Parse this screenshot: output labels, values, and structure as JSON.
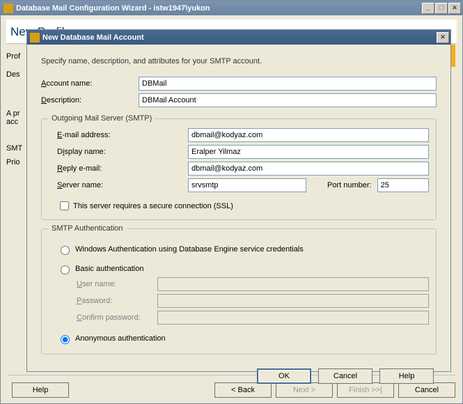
{
  "bg_window": {
    "title": "Database Mail Configuration Wizard - istw1947\\yukon",
    "heading_prefix": "New ",
    "heading_rest_trunc": "Profile",
    "labels": {
      "profile_short": "Prof",
      "desc_short": "Des",
      "smtp_short": "SMT",
      "priority_short": "Prio",
      "apr_line": "A pr",
      "acc_line": "acc"
    },
    "buttons": {
      "help": "Help",
      "back": "< Back",
      "next": "Next >",
      "finish": "Finish >>|",
      "cancel": "Cancel"
    }
  },
  "fg_window": {
    "title": "New Database Mail Account",
    "description": "Specify name, description, and attributes for your SMTP account.",
    "account_name_label": "Account name:",
    "account_name_value": "DBMail",
    "description_label": "Description:",
    "description_value": "DBMail Account",
    "smtp_legend": "Outgoing Mail Server (SMTP)",
    "email_label": "E-mail address:",
    "email_value": "dbmail@kodyaz.com",
    "display_label": "Display name:",
    "display_value": "Eralper Yilmaz",
    "reply_label": "Reply e-mail:",
    "reply_value": "dbmail@kodyaz.com",
    "server_label": "Server name:",
    "server_value": "srvsmtp",
    "port_label": "Port number:",
    "port_value": "25",
    "ssl_label": "This server requires a secure connection (SSL)",
    "ssl_checked": false,
    "auth_legend": "SMTP Authentication",
    "auth_windows": "Windows Authentication using Database Engine service credentials",
    "auth_basic": "Basic authentication",
    "basic_user": "User name:",
    "basic_pass": "Password:",
    "basic_confirm": "Confirm password:",
    "auth_anon": "Anonymous authentication",
    "auth_selected": "anon",
    "buttons": {
      "ok": "OK",
      "cancel": "Cancel",
      "help": "Help"
    }
  }
}
